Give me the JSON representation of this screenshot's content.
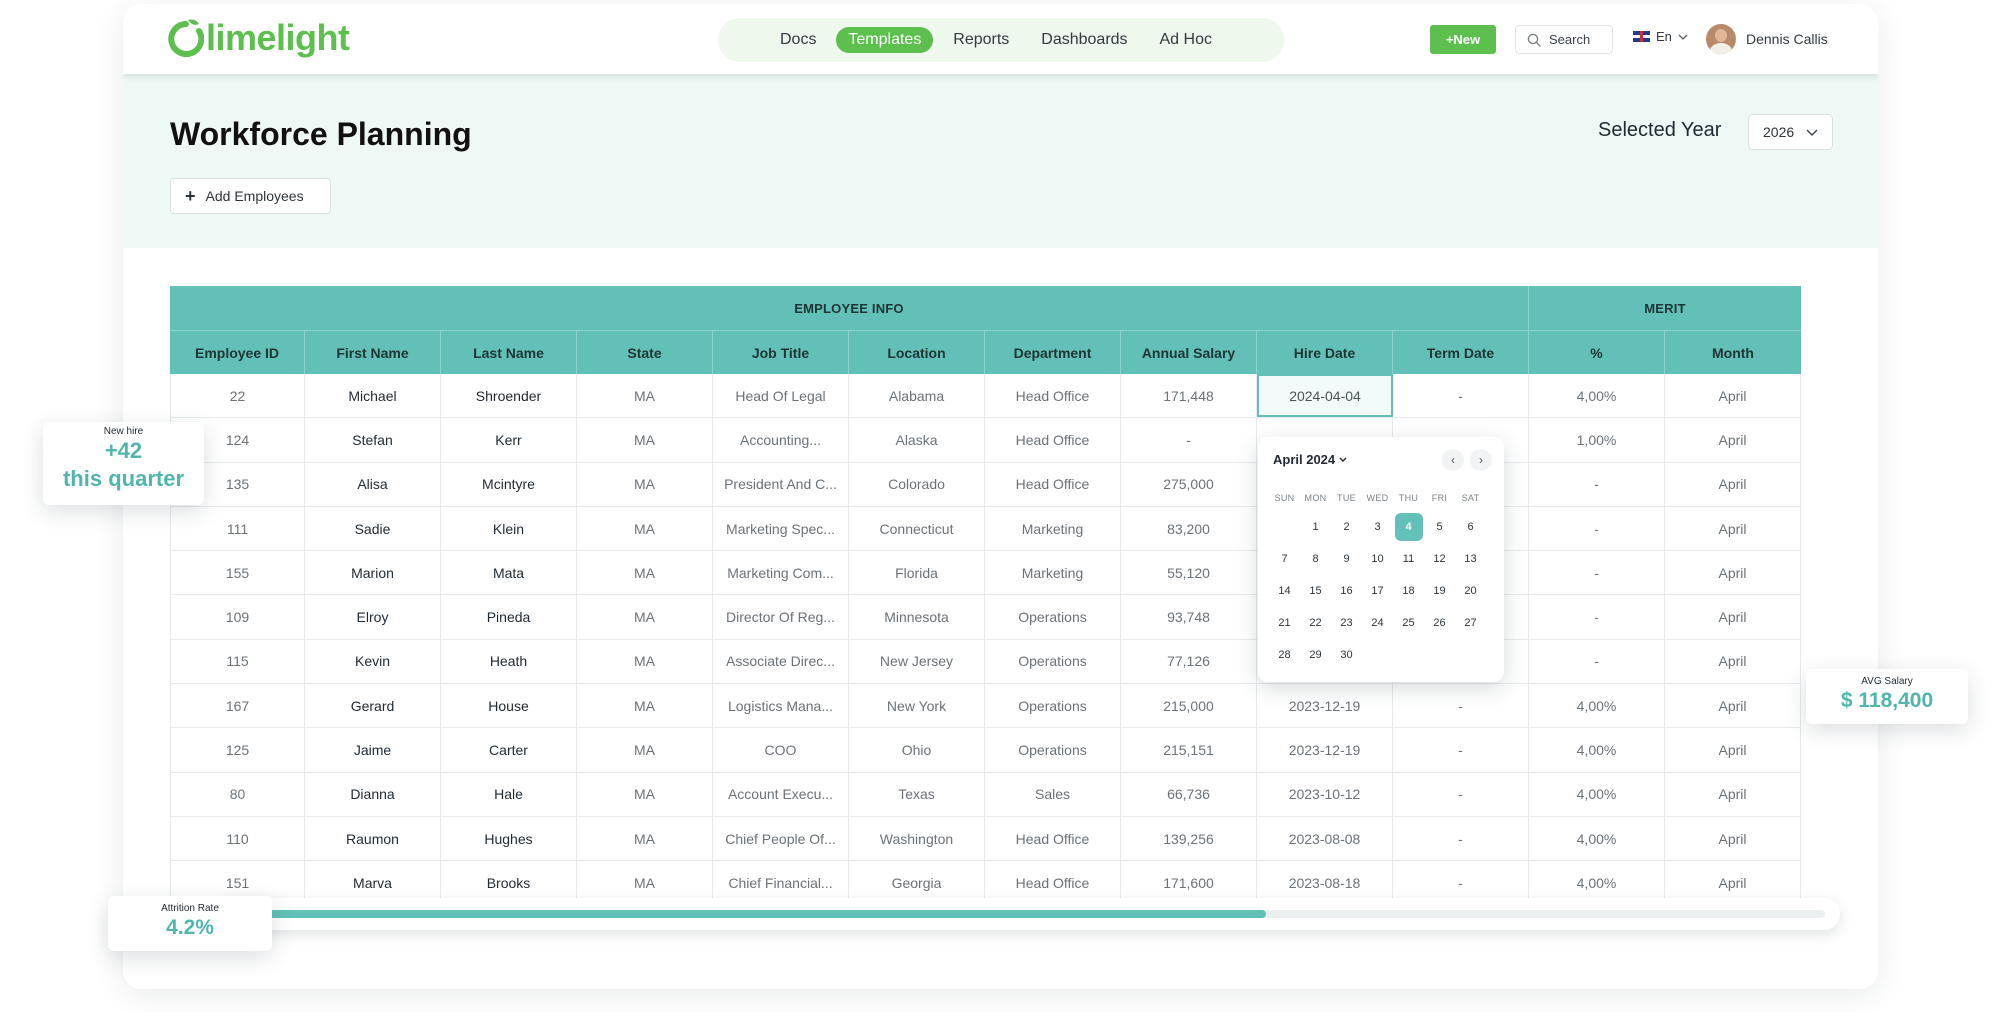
{
  "brand": {
    "name": "limelight",
    "color": "#5cbf4e",
    "accent": "#62c0b9"
  },
  "nav": {
    "items": [
      {
        "label": "Docs",
        "active": false
      },
      {
        "label": "Templates",
        "active": true
      },
      {
        "label": "Reports",
        "active": false
      },
      {
        "label": "Dashboards",
        "active": false
      },
      {
        "label": "Ad Hoc",
        "active": false
      }
    ]
  },
  "toolbar": {
    "new_label": "+New",
    "search_label": "Search",
    "language": "En",
    "user_name": "Dennis Callis"
  },
  "page": {
    "title": "Workforce Planning",
    "add_label": "Add Employees",
    "year_label": "Selected Year",
    "year_value": "2026"
  },
  "table": {
    "groups": [
      {
        "label": "EMPLOYEE INFO"
      },
      {
        "label": "MERIT"
      }
    ],
    "columns": [
      "Employee ID",
      "First Name",
      "Last Name",
      "State",
      "Job Title",
      "Location",
      "Department",
      "Annual Salary",
      "Hire Date",
      "Term Date",
      "%",
      "Month"
    ],
    "rows": [
      [
        "22",
        "Michael",
        "Shroender",
        "MA",
        "Head Of Legal",
        "Alabama",
        "Head Office",
        "171,448",
        "2024-04-04",
        "-",
        "4,00%",
        "April"
      ],
      [
        "124",
        "Stefan",
        "Kerr",
        "MA",
        "Accounting...",
        "Alaska",
        "Head Office",
        "-",
        "",
        "",
        "1,00%",
        "April"
      ],
      [
        "135",
        "Alisa",
        "Mcintyre",
        "MA",
        "President And C...",
        "Colorado",
        "Head Office",
        "275,000",
        "",
        "",
        "-",
        "April"
      ],
      [
        "111",
        "Sadie",
        "Klein",
        "MA",
        "Marketing Spec...",
        "Connecticut",
        "Marketing",
        "83,200",
        "",
        "",
        "-",
        "April"
      ],
      [
        "155",
        "Marion",
        "Mata",
        "MA",
        "Marketing Com...",
        "Florida",
        "Marketing",
        "55,120",
        "",
        "",
        "-",
        "April"
      ],
      [
        "109",
        "Elroy",
        "Pineda",
        "MA",
        "Director Of Reg...",
        "Minnesota",
        "Operations",
        "93,748",
        "",
        "",
        "-",
        "April"
      ],
      [
        "115",
        "Kevin",
        "Heath",
        "MA",
        "Associate Direc...",
        "New Jersey",
        "Operations",
        "77,126",
        "",
        "",
        "-",
        "April"
      ],
      [
        "167",
        "Gerard",
        "House",
        "MA",
        "Logistics Mana...",
        "New York",
        "Operations",
        "215,000",
        "2023-12-19",
        "-",
        "4,00%",
        "April"
      ],
      [
        "125",
        "Jaime",
        "Carter",
        "MA",
        "COO",
        "Ohio",
        "Operations",
        "215,151",
        "2023-12-19",
        "-",
        "4,00%",
        "April"
      ],
      [
        "80",
        "Dianna",
        "Hale",
        "MA",
        "Account Execu...",
        "Texas",
        "Sales",
        "66,736",
        "2023-10-12",
        "-",
        "4,00%",
        "April"
      ],
      [
        "110",
        "Raumon",
        "Hughes",
        "MA",
        "Chief People Of...",
        "Washington",
        "Head Office",
        "139,256",
        "2023-08-08",
        "-",
        "4,00%",
        "April"
      ],
      [
        "151",
        "Marva",
        "Brooks",
        "MA",
        "Chief Financial...",
        "Georgia",
        "Head Office",
        "171,600",
        "2023-08-18",
        "-",
        "4,00%",
        "April"
      ]
    ]
  },
  "datepicker": {
    "month_label": "April 2024",
    "weekdays": [
      "SUN",
      "MON",
      "TUE",
      "WED",
      "THU",
      "FRI",
      "SAT"
    ],
    "first_weekday_index": 1,
    "days_in_month": 30,
    "selected_day": 4
  },
  "widgets": {
    "new_hire": {
      "label": "New hire",
      "value_line1": "+42",
      "value_line2": "this quarter"
    },
    "avg_salary": {
      "label": "AVG Salary",
      "value": "$ 118,400"
    },
    "attrition": {
      "label": "Attrition Rate",
      "value": "4.2%"
    }
  },
  "scroll_progress": 0.645
}
